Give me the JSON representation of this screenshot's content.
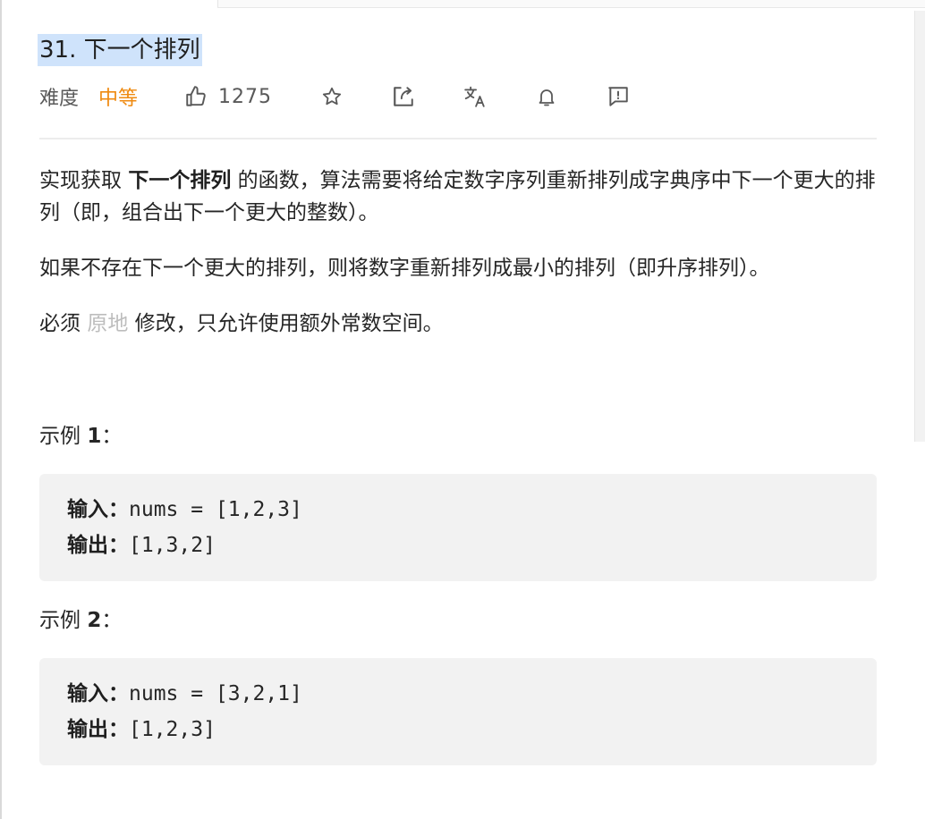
{
  "problem": {
    "title": "31. 下一个排列",
    "difficulty_label": "难度",
    "difficulty": "中等",
    "likes": "1275",
    "toolbar_icons": [
      "thumbs-up-icon",
      "star-icon",
      "share-icon",
      "translate-icon",
      "bell-icon",
      "feedback-icon"
    ]
  },
  "description": {
    "p1_pre": "实现获取 ",
    "p1_bold": "下一个排列",
    "p1_post": " 的函数，算法需要将给定数字序列重新排列成字典序中下一个更大的排列（即，组合出下一个更大的整数）。",
    "p2": "如果不存在下一个更大的排列，则将数字重新排列成最小的排列（即升序排列）。",
    "p3_pre": "必须 ",
    "p3_link": "原地",
    "p3_post": " 修改，只允许使用额外常数空间。"
  },
  "examples": [
    {
      "title_pre": "示例 ",
      "title_num": "1",
      "title_post": "：",
      "input_label": "输入：",
      "input_value": "nums = [1,2,3]",
      "output_label": "输出：",
      "output_value": "[1,3,2]"
    },
    {
      "title_pre": "示例 ",
      "title_num": "2",
      "title_post": "：",
      "input_label": "输入：",
      "input_value": "nums = [3,2,1]",
      "output_label": "输出：",
      "output_value": "[1,2,3]"
    }
  ],
  "colors": {
    "difficulty_medium": "#ef8a10",
    "title_highlight": "#cfe3fb",
    "code_background": "#f2f2f2",
    "muted_link": "#bdbdbd"
  }
}
